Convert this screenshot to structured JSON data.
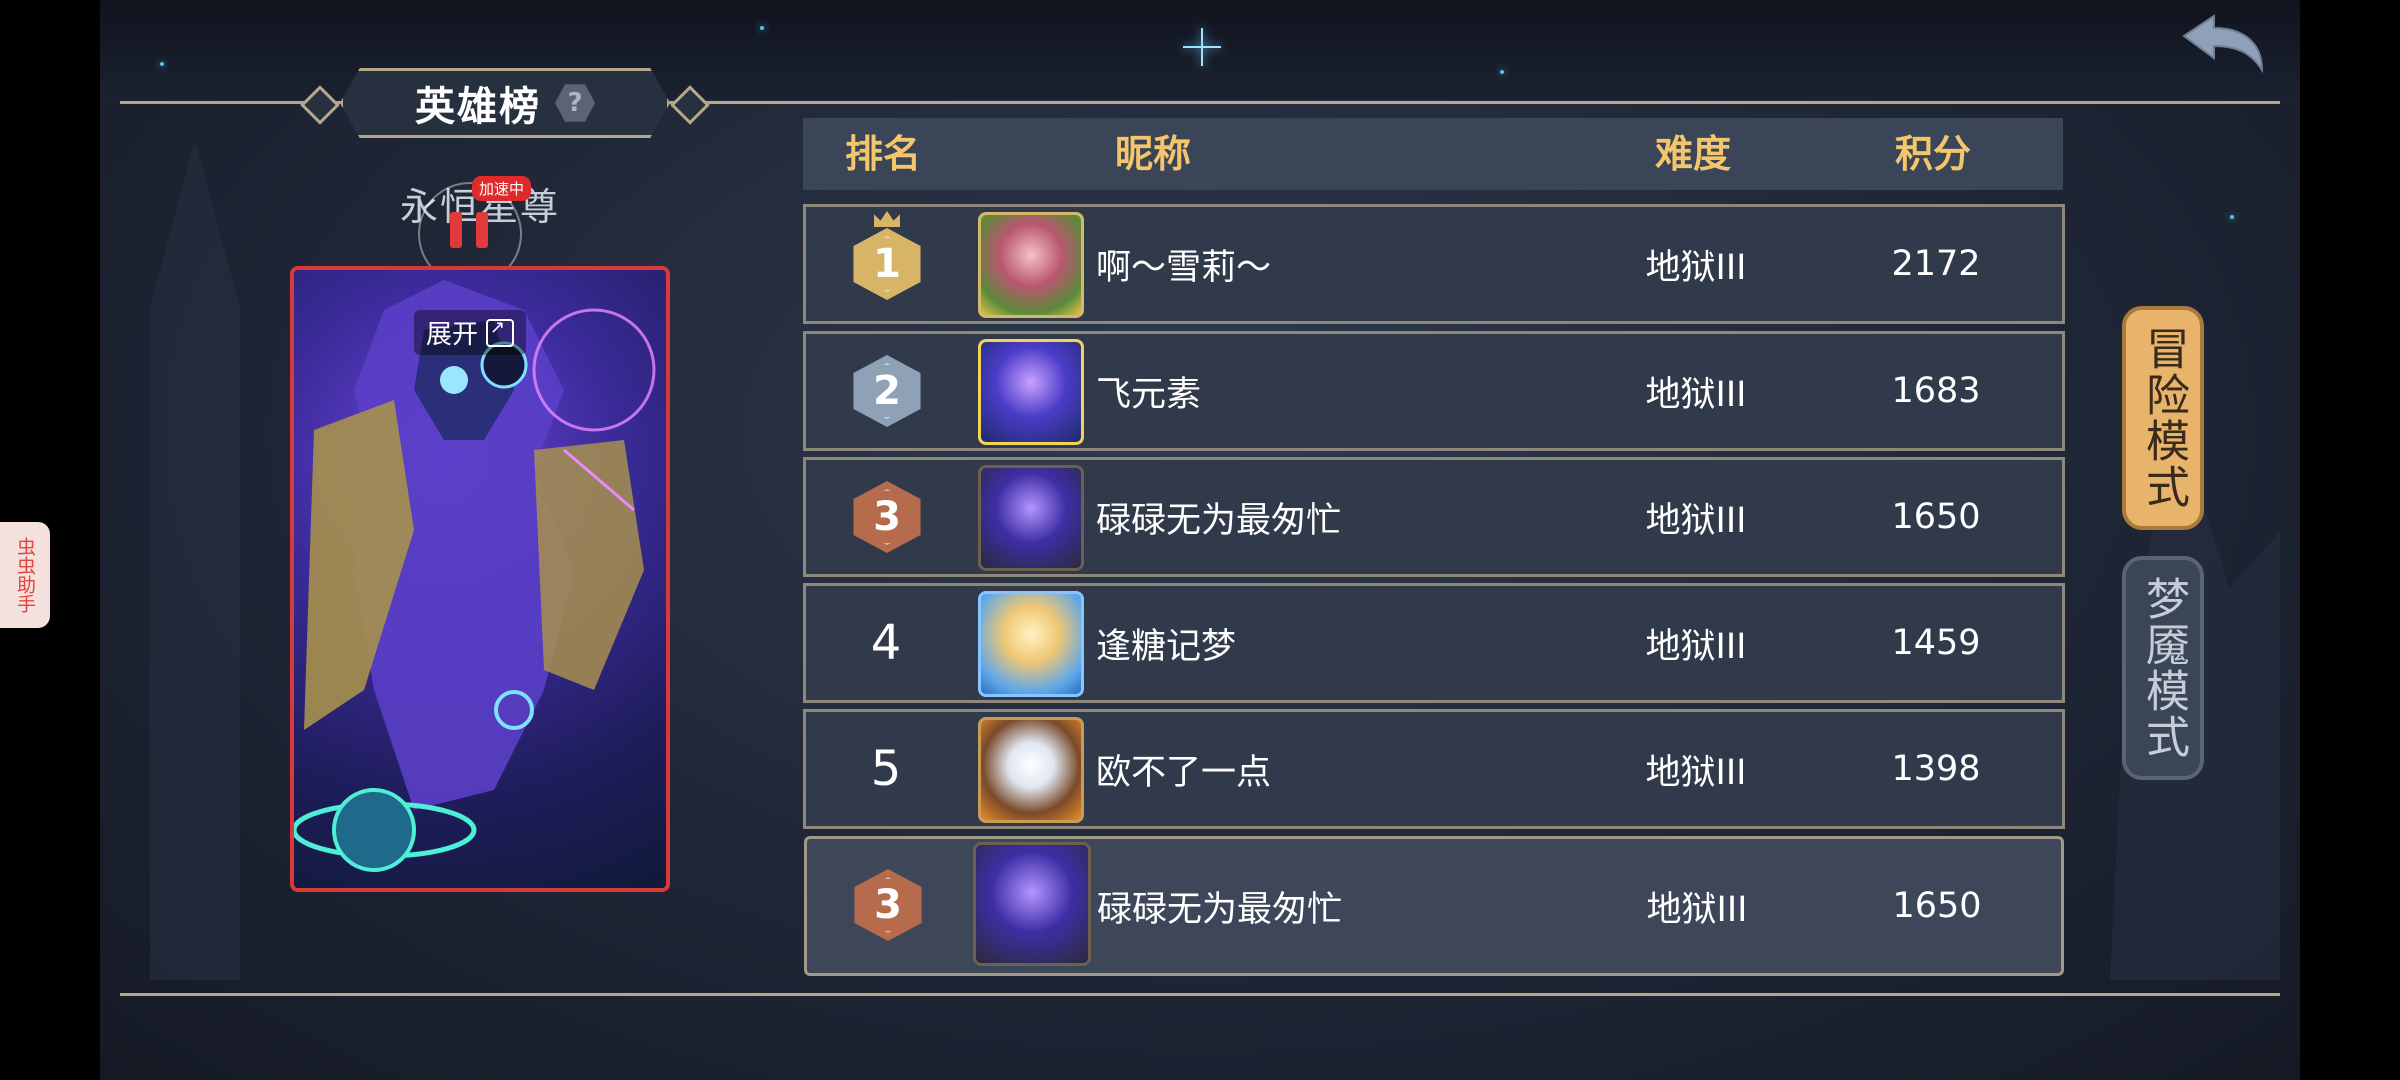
{
  "header": {
    "title": "英雄榜",
    "help_glyph": "?"
  },
  "hero": {
    "title": "永恒星尊",
    "speed_badge": "加速中",
    "expand_label": "展开"
  },
  "side_helper": {
    "label": "虫虫助手"
  },
  "table": {
    "columns": [
      "排名",
      "昵称",
      "难度",
      "积分"
    ],
    "rows": [
      {
        "rank": "1",
        "nickname": "啊～雪莉～",
        "difficulty": "地狱III",
        "score": "2172"
      },
      {
        "rank": "2",
        "nickname": "飞元素",
        "difficulty": "地狱III",
        "score": "1683"
      },
      {
        "rank": "3",
        "nickname": "碌碌无为最匆忙",
        "difficulty": "地狱III",
        "score": "1650"
      },
      {
        "rank": "4",
        "nickname": "逢糖记梦",
        "difficulty": "地狱III",
        "score": "1459"
      },
      {
        "rank": "5",
        "nickname": "欧不了一点",
        "difficulty": "地狱III",
        "score": "1398"
      }
    ],
    "self_row": {
      "rank": "3",
      "nickname": "碌碌无为最匆忙",
      "difficulty": "地狱III",
      "score": "1650"
    }
  },
  "modes": {
    "active": "冒险模式",
    "inactive": "梦魇模式"
  },
  "colors": {
    "header_text": "#f3c66b",
    "gold": "#d7b466",
    "silver": "#8fa1b6",
    "bronze": "#b56b4c",
    "active_tab": "#e8b36b"
  },
  "icons": [
    "back-arrow-icon",
    "help-icon",
    "expand-icon",
    "pause-icon",
    "crown-icon"
  ]
}
